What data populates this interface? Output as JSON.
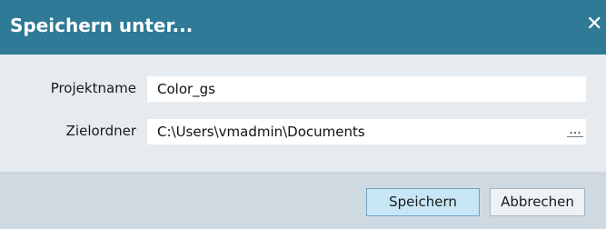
{
  "dialog": {
    "title": "Speichern unter...",
    "close_glyph": "✕"
  },
  "form": {
    "project_label": "Projektname",
    "project_value": "Color_gs",
    "folder_label": "Zielordner",
    "folder_value": "C:\\Users\\vmadmin\\Documents",
    "browse_label": "..."
  },
  "buttons": {
    "save_label": "Speichern",
    "cancel_label": "Abbrechen"
  },
  "colors": {
    "titlebar": "#2e7a97",
    "body": "#e6ebf0",
    "footer": "#cfd9e2",
    "primary_button": "#c7e6f6"
  },
  "icons": {
    "close": "close-icon",
    "browse": "ellipsis-icon"
  }
}
